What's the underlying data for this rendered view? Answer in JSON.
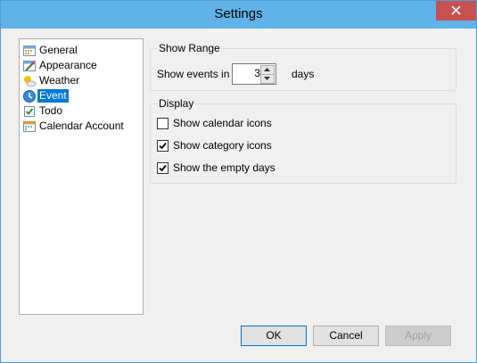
{
  "window": {
    "title": "Settings"
  },
  "tree": {
    "items": [
      {
        "label": "General",
        "icon": "general-settings-icon",
        "selected": false
      },
      {
        "label": "Appearance",
        "icon": "appearance-icon",
        "selected": false
      },
      {
        "label": "Weather",
        "icon": "weather-icon",
        "selected": false
      },
      {
        "label": "Event",
        "icon": "event-icon",
        "selected": true
      },
      {
        "label": "Todo",
        "icon": "todo-icon",
        "selected": false
      },
      {
        "label": "Calendar Account",
        "icon": "calendar-account-icon",
        "selected": false
      }
    ]
  },
  "show_range": {
    "title": "Show Range",
    "prefix": "Show events in",
    "value": "3",
    "suffix": "days"
  },
  "display": {
    "title": "Display",
    "options": [
      {
        "label": "Show calendar icons",
        "checked": false
      },
      {
        "label": "Show category icons",
        "checked": true
      },
      {
        "label": "Show the empty days",
        "checked": true
      }
    ]
  },
  "buttons": {
    "ok": "OK",
    "cancel": "Cancel",
    "apply": "Apply"
  }
}
